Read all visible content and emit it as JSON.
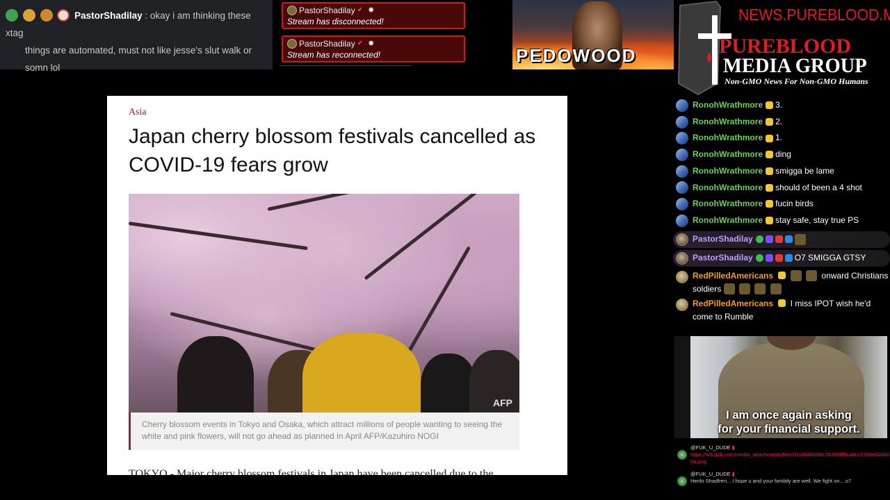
{
  "top_chat": {
    "username": "PastorShadilay",
    "separator": ":",
    "message_line1": "okay i am thinking these xtag",
    "message_line2": "things are automated, must not like jesse's slut walk or",
    "message_line3": "somn lol",
    "badge_colors": [
      "#3aa655",
      "#d9a23a",
      "#c98a2b",
      "#e8e0d0"
    ]
  },
  "alerts": [
    {
      "username": "PastorShadilay",
      "message": "Stream has disconnected!"
    },
    {
      "username": "PastorShadilay",
      "message": "Stream has reconnected!"
    }
  ],
  "banner": {
    "text": "PEDOWOOD"
  },
  "logo": {
    "url": "NEWS.PUREBLOOD.MEDIA",
    "line1": "PUREBLOOD",
    "line2": "MEDIA GROUP",
    "tagline": "Non-GMO News For Non-GMO Humans",
    "accent": "#e01b22"
  },
  "article": {
    "category": "Asia",
    "title": "Japan cherry blossom festivals cancelled as COVID-19 fears grow",
    "photo_credit": "AFP",
    "caption": "Cherry blossom events in Tokyo and Osaka, which attract millions of people wanting to seeing the white and pink flowers, will not go ahead as planned in April AFP/Kazuhiro NOGI",
    "body_start": "TOKYO - Major cherry blossom festivals in Japan have been cancelled due to the"
  },
  "chat": {
    "messages": [
      {
        "user": "RonohWrathmore",
        "text": "3."
      },
      {
        "user": "RonohWrathmore",
        "text": "2."
      },
      {
        "user": "RonohWrathmore",
        "text": "1."
      },
      {
        "user": "RonohWrathmore",
        "text": "ding"
      },
      {
        "user": "RonohWrathmore",
        "text": "smigga be lame"
      },
      {
        "user": "RonohWrathmore",
        "text": "should of been a 4 shot"
      },
      {
        "user": "RonohWrathmore",
        "text": "fucin birds"
      },
      {
        "user": "RonohWrathmore",
        "text": "stay safe, stay true PS"
      },
      {
        "user": "PastorShadilay",
        "text": ""
      },
      {
        "user": "PastorShadilay",
        "text": "O7 SMIGGA GTSY"
      },
      {
        "user": "RedPilledAmericans",
        "text": "onward Christians",
        "text2": "soldiers"
      },
      {
        "user": "RedPilledAmericans",
        "text": "I miss IPOT wish he'd",
        "text2": "come to Rumble"
      }
    ]
  },
  "video": {
    "caption_line1": "I am once again asking",
    "caption_line2": "for your financial support."
  },
  "mini_chat": [
    {
      "user": "@FUK_U_DUDE",
      "text": "https://w3.gob.com/media_attachments/files/010/6d8fd98c2838f9ff8c4dcc07e8e6bbb00a.png"
    },
    {
      "user": "@FUK_U_DUDE",
      "text": "Henlo Shadfren... I hope u and your fambily are well. We fight on... o7"
    }
  ]
}
